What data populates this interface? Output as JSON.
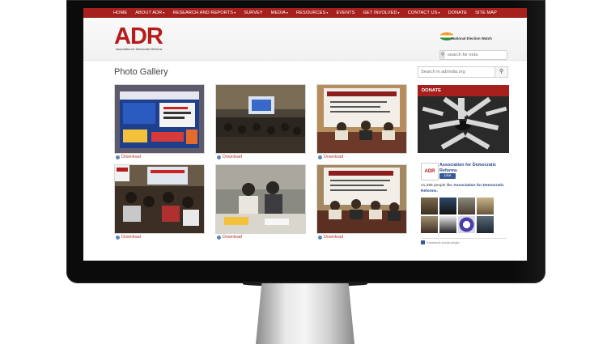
{
  "nav": {
    "items": [
      {
        "label": "HOME",
        "caret": ""
      },
      {
        "label": "ABOUT ADR",
        "caret": "▾"
      },
      {
        "label": "RESEARCH AND REPORTS",
        "caret": "▾"
      },
      {
        "label": "SURVEY",
        "caret": ""
      },
      {
        "label": "MEDIA",
        "caret": "▾"
      },
      {
        "label": "RESOURCES",
        "caret": "▾"
      },
      {
        "label": "EVENTS",
        "caret": ""
      },
      {
        "label": "GET INVOLVED",
        "caret": "▾"
      },
      {
        "label": "CONTACT US",
        "caret": "▾"
      },
      {
        "label": "DONATE",
        "caret": ""
      },
      {
        "label": "SITE MAP",
        "caret": ""
      }
    ]
  },
  "header": {
    "logo_text": "ADR",
    "logo_tagline": "Association for Democratic Reforms",
    "partner_logo_text": "National Election Watch",
    "neta_search_placeholder": "search for neta"
  },
  "gallery": {
    "title": "Photo Gallery",
    "download_label": "Download",
    "photos": [
      {
        "name": "photo-1",
        "scene": "banner"
      },
      {
        "name": "photo-2",
        "scene": "conference-hall"
      },
      {
        "name": "photo-3",
        "scene": "panel-banner"
      },
      {
        "name": "photo-4",
        "scene": "audience"
      },
      {
        "name": "photo-5",
        "scene": "press-table"
      },
      {
        "name": "photo-6",
        "scene": "panel-banner"
      }
    ]
  },
  "sidebar": {
    "search_placeholder": "Search in adrindia.org",
    "donate_label": "DONATE",
    "facebook": {
      "page_name": "Association for Democratic Reforms",
      "like_label": "Like",
      "likes_text": "41,486 people like",
      "likes_page": "Association for Democratic Reforms.",
      "plugin_label": "Facebook social plugin"
    }
  },
  "colors": {
    "brand_red": "#a6201d",
    "facebook_blue": "#3b5998"
  }
}
